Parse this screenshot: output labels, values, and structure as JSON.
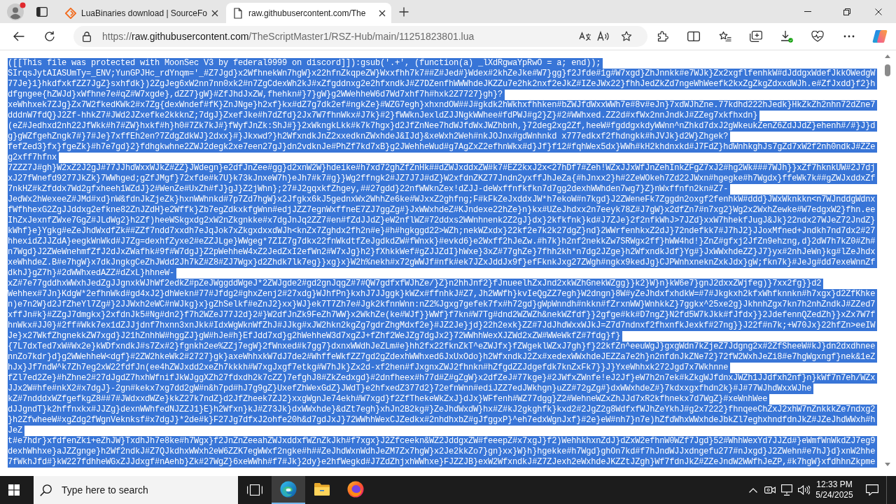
{
  "tabs": [
    {
      "title": "LuaBinaries download | SourceFo",
      "selected": false
    },
    {
      "title": "raw.githubusercontent.com/The",
      "selected": true
    }
  ],
  "address_bar": {
    "scheme": "https://",
    "host": "raw.githubusercontent.com",
    "path": "/TheScriptMaster1/RSZ-Hub/main/11251823801.lua"
  },
  "document": {
    "selected": true,
    "lines": [
      "([[This file was protected with MoonSec V3 by federal9999 on discord]]):gsub('.+', (function(a) _lXdRgwaYpRwO = a; end));",
      "SIrqsJytAIASUmTy=_ENV;YunGPJHc_rdYnqm='_#Z7Jgd}x2WfhnekWn7hgW}x22hfnZkqpeZW}Wxxfhh7k7##Z#Jed#}Wdex#2khZeJke#W7}gg}f2Jfde#1g#W7xgd}ZhJnnkk#e7WJk}Zx2xgflfenhkW#dJddgxWdefJkkOWedgW",
      "77Je}1}hkdfxkfZZ7JgZ}sxhfdk})2ZgJeg6xW2nn7nn0xk2#n7ZgCdexWh2kJ#xZfgddnxg2e2hfxndkJ#Z7DZenfhWWWhdeJKZZu7e2hk2nxf2eJkZ#IZeJWx22}fhhJedZkZd7ngeWhWeefk2kxZgZkgZdxxdWJh.e#ZfJxdd}f2}h",
      "dfgngee{hZWJd}xWfhne7e#qZ#W7xgde},dZZ7}gW}#ZfJhdJxZW,fhehkn#}7}gW}g2WWehheW6d7Wd7xhf7h#hxk2Z7727}gh}?",
      "xeWhhxek7ZJg}Zx7W2fkedKWk2#x7Zg{dexWndef#fK}ZnJNge}h2xf}kx#dZ7g7dk2ef#ngkZe}#WZG7egh}xhxndOW##J#gkdk2hWkhxfhhken#bZWJfdWxxWWh7e#8v#eJn}7xdWJhZne.77kdhd222hJedk}HkZkZh2nhn72dZne7",
      "dddnW7fdQ}J2Zf-hhkZ7#JWd2JZxefke2kkknZ;7dgJ}ZxefJke#h7dZfd}2Jx7W7fhnWkx#J7k}#2}fWWknJexldZJJNgkWWhee#fdPWJ#g2}Z}#2#WWhxed.ZZ2d#xfWx2nnJndkJ#ZZeg7xkfhxdn}",
      "(eZ#Jedhxd2nh22JfWkk#h7#ZW}hxkf#h}h0#7Zk7kJ#}fWyfJnZk:ShJ#}}2xWkngkLkk#k7k7hgx}d2JfZnNee7hdWJfdWxJWZhbnh,}72deg2xg2Zf,heeW#fgddgxkdyWWnn^nZhkd7dxJ2gWkeukZenZ6ZdJJdZ}ehenh#/#}J}d",
      "g}gWZfgehZngk7#}7#Je}7xffEh2en?7ZdgZdkWJ}2dxx}#}Jkxwd?}h2WfxndkJnZ2xxedknZWxhdeJ&IJd}&xeWxh2Weh#nkJOJnx#gdWnhnkd x777edkxf2fhdngkk#hJVJk}d2W}Zhgek?",
      "fefZed3}fx}fgeZk}#h7e7gd}2}fdhgkwhne2ZWJ2degk2xe7een27gJ}dn2vdknJe#PhZf7kd7xB}g2JWehheWud#g7AgZxZ2efhnWkx#d}Jf}f12#fqhWex5dx}WWh#kH2khdnxkd#J7FdZ}hdWnhkghJs7gZd7xW2f2nh0ndkJ#ZZe",
      "g2xff7hfnx",
      "7ZZZ7J#gh}W2xZ2J2gJ#77JJhdWxxWJkZ#ZZ}JWdegn}e2dfJnZee#gg}d2xnW2W}hdeike#h7xd72ghZfZnHk##dZWJxddxZW#k7#EZ2kxJ2x<27hDf7#Zeh!WZxJJxWfJnZehInkZFgZ7xJ2#hg2Wk###7WJh}}xZf7hknkUW#2J7dj",
      "xJ27fWnefd9277JkZk}7WWhged;gZfJMgf}72xfde#k7U}k73kJnxeW7h}eJh7#k7#g}}Wg2ffngk2#JZ7J7J#dZ}W2xfdnZKZ77Jndn2yxffJhJeZa{#hJnxx2}h#2ZeWOkeh7Zd22JWxn#hgegke#h7Wgdx}ffeWk7k##gZWJxddxZf",
      "7nkHZ#kZfddx7Wd2gfxheeh1WZdJ}2#WenZe#UxZh#fJ}gJ}Z2jWhn};27#J2gqxkfZhgey,##27gdd}22nfWWknZex!dZJJ-deWxffnfkfkn7d7gg2dexhWWhden7wg7}Z}nWxffnfn2kn#Z7-",
      "JedWx2hWexeeZ#JMd#xd}nW&fdnJkZjeZk}hxnWWhnkd#7p7Zd7hgW}x2Jfgkx6kJ5gednxWx2WhhZe6ke#WJxxZ2ghfng;F#kFkZeJxddxJW*h7ekoW#n7kgd}J2ZWeneFk7Zggdn2oxgf2fenhkW#ddd}JWxWknkkn<n7WJnddgWdnx",
      "fWfhhexG2ZgJJddxg2efkne82ZnJZdH}e2Wffk}Zb7egZdkxkfgWnn#edjJZZ7egnWxffneE7ZJ7ggZg#}JxWWxhdeZ#KJndexe22hZe}n}kx#UZeJhdxx2n7eeyk78Z#J7gW}x2dfZn7#n7xg2}Wg2x2WxhZewke#W7edgxW2}fhn.ee",
      "IhZxJexnfZWxe7GgZ#JLdWg2}h2Zf)heeWSkgxdg2xW2nZkgnkke#x7dgJnJq2ZZ7#en#fZdJJdZ}eW2nflWZ#72ddxs2WWnhnenk2Z2gJ}dx}2kfkfnk}kd#J7ZJe}2f2nfkWhJ>7JZd}xxW7hhekfJugJ&Jk}22ndx27WJeZ72JndZ}",
      "kWhf}e}Ygkg#eZeJhdWxdfZk##ZZf7ndd7xxdh7eJqJok7xZkgxdxxdWJh<knZx7Zghdx2fh2n#e}#h#hgkggd22>WZh;nekWZxdx}22kf2e7k2k27dgZ}nd}2WWrfenhkxZ2dJ}72ndefkk7#J7hJ2}JJoxMfned+Jndkh7nd7dx2#27",
      "hhexidZJJZdA}eegkWnWkd#J7Zg=dexhfZyxe2#eZZJLge}WWgeg*7ZIZ7g7dkx22fnWkdtfZeJgdkdZW#fWnxk}#evkd6}e2Wxff2hJeZw.#h7k}h2nf2nekkZw7SRWgx2ff}hWW4hd!}ZnZ#gfxj2JfZn9ehzng,d}2dW7h7kZ0#Zh#",
      "n7Wgd}J2ZWeWnehmfZfJ2dJxZWafhk#9f#W7dgJ}Z2pWehheW4xZ2JedZxI2efWn2#W7xJg}h2}fXhkkWef#gZJJZdI}hWxe}3xZ#77ghZe}7fhh2kh*n7dg2JZge}h2WfxndkJdf}Yg#}JxWWxhdeZZ}J7}yx#2nhJeWn}kg#lZeJhdx",
      "xeWhhdeZ.B#e7hgW}x7dkJngkgCeZhJWdd2Jh7kZ#Z8#ZJ7Wgx}d2Zhdk7lk7eg}}xg}x}W2h%nekh#x72gWWJf#nfk#ek7JZxJddJx9f}efFknkJxg27ZWgh#ngkx9kedJg}CJPWnhxneknZxkJdx}gW;fkn7k}#JeJg#dd7exeWnnZf",
      "dkhJ}gZ7h}#2dWWhxedAZZ#dZxL}hhneW-",
      "xZ#7e77gddhxWWxhJedZgJJgnxkWJhWf2edkZ#pZeJWggddWgeJ*2ZWJgde2#gd2gnJqgZ#7#QW7gdfxfWJhZe/}Z}n2hhJnf2}fJnueelhZxJnd2xkWZhGnekWZgg}}k2}W}n}kW6e7}gnJ2dxxZWjfeg)}7xx2fg}}d2",
      "Wehhex#7Jn}KdgW*2efhnWkd#gd4xJ2}dhWekn#77#Jfdg2#ghxZenj2#27xdg}WJhfPn}kxhJ7JJggk}kWZx#ffnhkJ#Z7,Jh2WWfh}kvIeQgZZ7egh}W2dngn}8W#yZeJhdxfxhdkW=#7#Jkgkxh2kfxWhfknnkn#h7xgx}d2ZfKhke",
      "n)e7n2W}d2JfZheYl7Zg#}2JJWxh2eWC#nWJkg}x}gZhSelkf#eZnJ2}xx}WJ}ek7T7Zh7e#Jgk2kfnnWnn:nZ2%Jgxg7gefek7fx#h72gd}gWpWnndh#nkkn#fZrxnWW}WnhkkZ}7ggkx^25xe2g}JkhnhZgx7kn7h2nhZndkJ#ZZed7",
      "xffJn#k}#ZZgJ7dmgkx}2xfdnJk5#Ng#dn2}f7h2WZeJ77J2d}2#}W2dfJnZk9FeZh7WW}x2WkhZe(ke#WJf}}WWf}f7kn#W7Tg#dnd2WZWZh&nekWZfdf}}2gfge#kk#D7ngZ}N2fd5W7kJkk#fJfdx}}2JdefennQZedZh}}xZx7W7f",
      "hnWkx#JJ0}#2ff#Wkk7ex1dZJJjdnf7hxnn3xnJkk#IdxWgWknWfZhJ#JJkg#xJW2hkn2kgZg7gdrZhgMdxf2e}#JZ2Je}jd}22h2exk}ZZ#7JdJhdWxxWJkJ=Z7d7ndnxf2fhxnfkJexkf#27ng}}J22f#n7k;+W70Jx}22hfZn>eeIW",
      "Je}x27WkfZhgnekkZW7xgd}J21hZnhhW#hggZJ}gW#hJe#h}EfJdd7xd}g2hWehheW3d7xgZJ+fZhf2WeJZg7dgJx2}72WWhhWexXJZWd2xZW#WWeWkfZ#7fdg}f}",
      "{7L7dxTed7xW#Wx2e}kWDfxndkJ#s7Zx#2}fgnkh2ee%ZZj7egW}2fWnxed#k7gg7}dxnxWWdhJeZLm#e}hh2fx22fknZkT^eZWJfx}fZWgeklWZxJ7gh}f}22kfZn^eeuWgJ}gxgWdn7kZjeZ7Jdgng2x#2ZfSheeW#kJ}dn2dxdhnee",
      "nnZo7kdr}d}g2WWehheW<dgf}#2ZW2hkeWk2#2727}gk}axeWhhxkW7dJ7de2#WhffeWkfZZ7gd2gZdexhWWhxed6JxUxOdo}h2WfxndkJ2Zx#xedexWWxhdeJEZZa7e2h}n2nfdnJkZNe72}72fW2WxhJeZi8#e7hgWgxngf}nek&1eZ",
      "hJx}Jf7ndW^k7Zh7eg2xW22fdfJn(ee4hZWJxdd2xeZh7kkkh#W7xgJxgf7etkg#W7hJk}Zx2d-xf2hen#fJxgnxZWJ2fhnkn#hZfgdZZJdgefdk7knZxFk7}}J}YxeWhhxk272Jgd7x7Wkhnne",
      "fZl7ed2Ze}#hZhne2#27dJgdZ7hxhWfnifJkWJggXZh27fdxdh2k7cZZ)7efghJ8#ZkZedxgd}#2dnfheex#h77d#Z#gZgW}x2dfZeJ#77kge}#2JWfxZWnfe!eJ2Jf}eW7h2n7ek#kZkgWJfdnxJWZh1JJdfxh2nf}n}kWf7n7eh/WZx",
      "JJx2W#hfe#nkX2#x7dgJ}-2gn#kekx7xg7dd2gW#n&h7pd#hJ7g9gZ}UxefZhWexGdZ}JWdT}e2hfxedZ377d2}72efnWnn#ediJZZ7edJWkhgn}uZZ#72gZg#}dxWWxhdeZ#}7kdxxgxfhdn2k}#J#77WJhdWxxWJhe",
      "kZ#7ndddxWZfgefkgZ8##7#JWdxxdWZe}kkZ27k7ndZ}d2JfZheek7ZJ2}xxgWgnJe74ekh#W7xgd}f2ZfThekeWkZxJ}dJx}WFfenh#WZ77dgg}Z2#WehneWZxZhJJd7xR2kfhnekx7d7WgZ}#xeWnhWee",
      "dJJgndT}k2hffnxkx#JJZg}dexnWWhfedNJZZJ1}E}h2Wfxn}kJ#Z73Jk}dxWWxhde}&dZt7egh}xhJn2B2kg#}ZeJhdWxdW}hx#Z#kJ2gkghfk}kxd2#2JgZ2g8WdfxfWJhZeYkhJ#g2x7222}fhnqeeChZxJ2xhW7nZnkkkZe7ndxg2",
      "}h2ZfwheeW#xgZdg2fWgnVeknksf#x7dgJ}*2de#k}F27Jg7dfxJ2ohfe20h&d7gdJxJ}72WWhhWexCJZedkx#2nhdhxbZ#gJfggxP}^eh7edxWgnJxf}#2e}eW#nh7}n7e)hZfdWhxWWxhdeJbkZl7eghxhndfdnJkZ#JZeJhdWWxh#h",
      "JeZ",
      "t#e7hdr}xfdfenZki+eZhJW}TxdhJh7e8ke#h7Wgx}f2JnZnZeeahZWJxddxfWZnZkJkh#f7xgx}J2Zfceekn&WZ2JddgxZW#feeepZ#x7xgJ}f2)WehhkhxnZdJ}dZxW2efhnW0WZf7Jgd}52#WhhWexYd7JJZd#}eWmfWnWkdZJ7eg9",
      "dexhWhhxe}aJZZgnge}h2Wf2ndkJ#Z7QJkdhxWWxh2eW6ZZK7egWWxf2ngke#h##ZeJhdWxnWdhJeZM7Zx7hgW}x2Je2kkZo7}gn}xx}W}h}hgekke#h7Wgd}ghOn7kd#f7hJndWJJxdngefu277#nJxgd}J2ZWehn#e7hJ}d}xnW2hhe",
      "7fWkhJfd#}kW227fdhheWGxZJJdxgf#nAehb}Zk#27WgZ}6xeWWhh#f7#Jk}2dy}e2hfWegkd#J7ZdZhjxhWWhxe}FJZZJB}exW2WfxndkJ#Z7ZJexh2eWxhdeJKZZtJZgh}Wf7fdnJkZ#ZZeJndW2WWfhJeZP,#k7hgW}xfdhhnZkpme"
    ]
  },
  "taskbar": {
    "search": {
      "placeholder": "Type here to search"
    },
    "apps": [
      {
        "selected": true
      },
      {
        "selected": false
      },
      {
        "selected": false
      }
    ],
    "time": "12:33 PM",
    "date": "5/24/2025"
  }
}
